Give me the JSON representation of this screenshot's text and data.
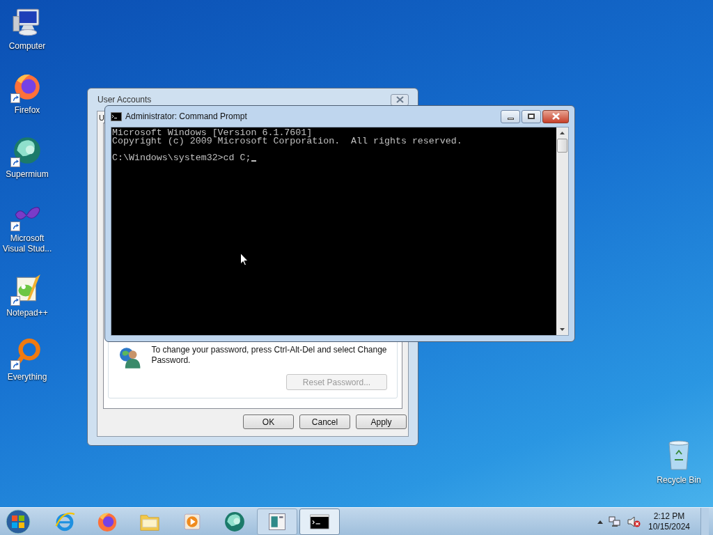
{
  "desktop_icons": [
    {
      "label": "Computer",
      "kind": "computer",
      "shortcut": false
    },
    {
      "label": "Firefox",
      "kind": "firefox",
      "shortcut": true
    },
    {
      "label": "Supermium",
      "kind": "supermium",
      "shortcut": true
    },
    {
      "label": "Microsoft Visual Stud...",
      "kind": "visualstudio",
      "shortcut": true
    },
    {
      "label": "Notepad++",
      "kind": "notepad",
      "shortcut": true
    },
    {
      "label": "Everything",
      "kind": "everything",
      "shortcut": true
    }
  ],
  "recycle_bin": {
    "label": "Recycle Bin"
  },
  "user_accounts": {
    "title": "User Accounts",
    "tab_label": "U",
    "info_text": "To change your password, press Ctrl-Alt-Del and select Change Password.",
    "reset_button": {
      "label": "Reset Password...",
      "disabled": true
    },
    "buttons": [
      "OK",
      "Cancel",
      "Apply"
    ]
  },
  "console": {
    "title": "Administrator: Command Prompt",
    "output": [
      "Microsoft Windows [Version 6.1.7601]",
      "Copyright (c) 2009 Microsoft Corporation.  All rights reserved."
    ],
    "prompt": "C:\\Windows\\system32>cd C;"
  },
  "taskbar": {
    "items": [
      {
        "kind": "ie",
        "selected": false
      },
      {
        "kind": "firefox",
        "selected": false
      },
      {
        "kind": "explorer",
        "selected": false
      },
      {
        "kind": "mediaplayer",
        "selected": false
      },
      {
        "kind": "supermium",
        "selected": false
      },
      {
        "kind": "useraccounts",
        "selected": false
      },
      {
        "kind": "cmd",
        "selected": true
      }
    ],
    "volume_muted": true,
    "clock": {
      "time": "2:12 PM",
      "date": "10/15/2024"
    }
  }
}
